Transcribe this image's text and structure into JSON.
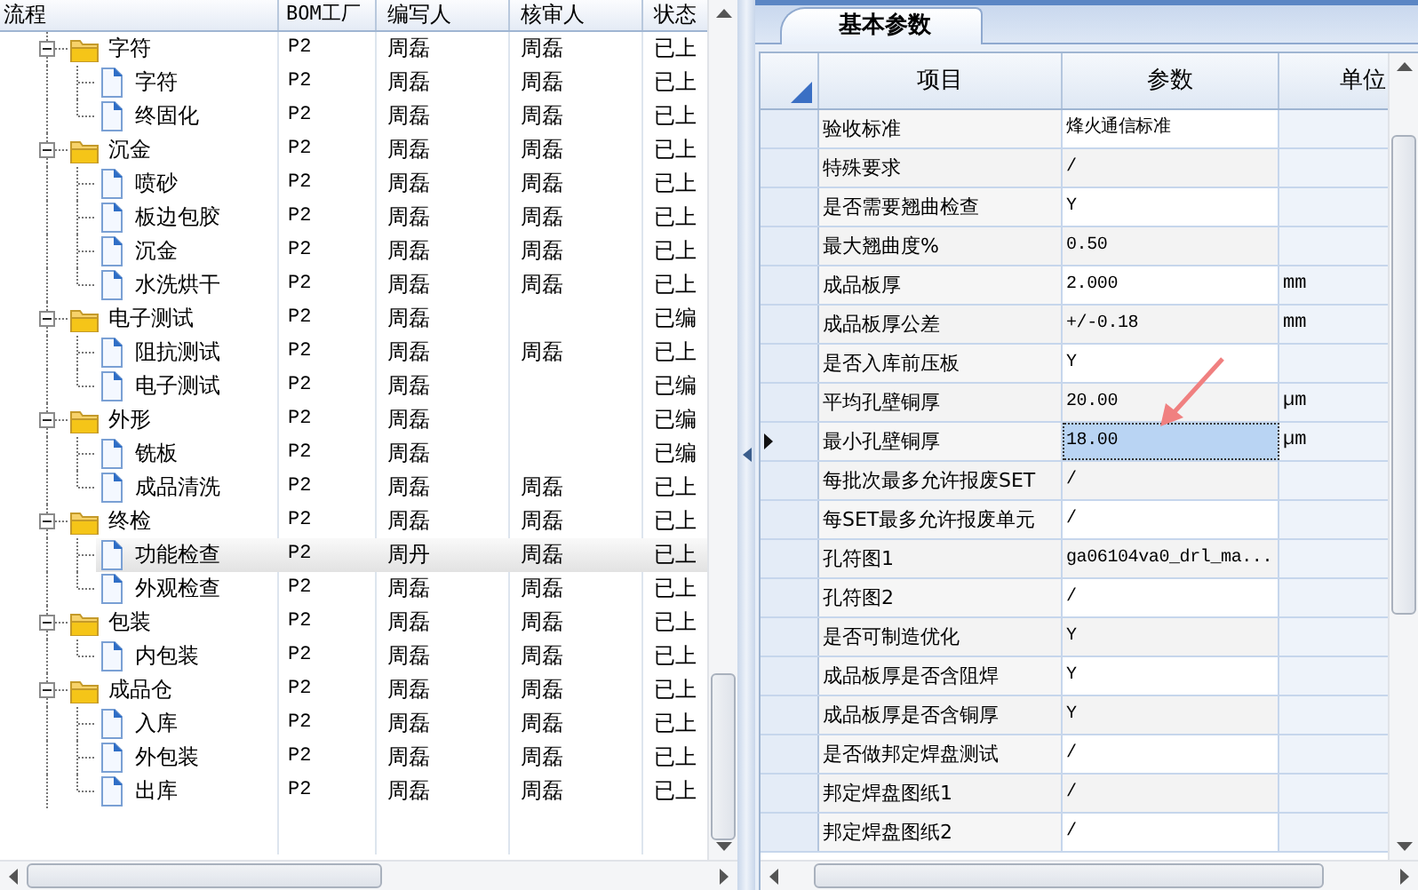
{
  "tree_table": {
    "columns": [
      "流程",
      "BOM工厂",
      "编写人",
      "核审人",
      "状态"
    ],
    "rows": [
      {
        "name": "字符",
        "expanded": true,
        "factory": "P2",
        "author": "周磊",
        "reviewer": "周磊",
        "status": "已上",
        "selected": false,
        "children": [
          {
            "name": "字符",
            "factory": "P2",
            "author": "周磊",
            "reviewer": "周磊",
            "status": "已上",
            "selected": false
          },
          {
            "name": "终固化",
            "factory": "P2",
            "author": "周磊",
            "reviewer": "周磊",
            "status": "已上",
            "selected": false
          }
        ]
      },
      {
        "name": "沉金",
        "expanded": true,
        "factory": "P2",
        "author": "周磊",
        "reviewer": "周磊",
        "status": "已上",
        "selected": false,
        "children": [
          {
            "name": "喷砂",
            "factory": "P2",
            "author": "周磊",
            "reviewer": "周磊",
            "status": "已上",
            "selected": false
          },
          {
            "name": "板边包胶",
            "factory": "P2",
            "author": "周磊",
            "reviewer": "周磊",
            "status": "已上",
            "selected": false
          },
          {
            "name": "沉金",
            "factory": "P2",
            "author": "周磊",
            "reviewer": "周磊",
            "status": "已上",
            "selected": false
          },
          {
            "name": "水洗烘干",
            "factory": "P2",
            "author": "周磊",
            "reviewer": "周磊",
            "status": "已上",
            "selected": false
          }
        ]
      },
      {
        "name": "电子测试",
        "expanded": true,
        "factory": "P2",
        "author": "周磊",
        "status": "已编",
        "selected": false,
        "children": [
          {
            "name": "阻抗测试",
            "factory": "P2",
            "author": "周磊",
            "reviewer": "周磊",
            "status": "已上",
            "selected": false
          },
          {
            "name": "电子测试",
            "factory": "P2",
            "author": "周磊",
            "status": "已编",
            "selected": false
          }
        ]
      },
      {
        "name": "外形",
        "expanded": true,
        "factory": "P2",
        "author": "周磊",
        "status": "已编",
        "selected": false,
        "children": [
          {
            "name": "铣板",
            "factory": "P2",
            "author": "周磊",
            "status": "已编",
            "selected": false
          },
          {
            "name": "成品清洗",
            "factory": "P2",
            "author": "周磊",
            "reviewer": "周磊",
            "status": "已上",
            "selected": false
          }
        ]
      },
      {
        "name": "终检",
        "expanded": true,
        "factory": "P2",
        "author": "周磊",
        "reviewer": "周磊",
        "status": "已上",
        "selected": false,
        "children": [
          {
            "name": "功能检查",
            "factory": "P2",
            "author": "周丹",
            "reviewer": "周磊",
            "status": "已上",
            "selected": true
          },
          {
            "name": "外观检查",
            "factory": "P2",
            "author": "周磊",
            "reviewer": "周磊",
            "status": "已上",
            "selected": false
          }
        ]
      },
      {
        "name": "包装",
        "expanded": true,
        "factory": "P2",
        "author": "周磊",
        "reviewer": "周磊",
        "status": "已上",
        "selected": false,
        "children": [
          {
            "name": "内包装",
            "factory": "P2",
            "author": "周磊",
            "reviewer": "周磊",
            "status": "已上",
            "selected": false
          }
        ]
      },
      {
        "name": "成品仓",
        "expanded": true,
        "factory": "P2",
        "author": "周磊",
        "reviewer": "周磊",
        "status": "已上",
        "selected": false,
        "children": [
          {
            "name": "入库",
            "factory": "P2",
            "author": "周磊",
            "reviewer": "周磊",
            "status": "已上",
            "selected": false
          },
          {
            "name": "外包装",
            "factory": "P2",
            "author": "周磊",
            "reviewer": "周磊",
            "status": "已上",
            "selected": false
          },
          {
            "name": "出库",
            "factory": "P2",
            "author": "周磊",
            "reviewer": "周磊",
            "status": "已上",
            "selected": false
          }
        ]
      }
    ]
  },
  "tabs": [
    {
      "label": "基本参数",
      "selected": true
    }
  ],
  "param_grid": {
    "columns": [
      "项目",
      "参数",
      "单位"
    ],
    "rows": [
      {
        "item": "验收标准",
        "value": "烽火通信标准",
        "selected": false
      },
      {
        "item": "特殊要求",
        "value": "/",
        "selected": false
      },
      {
        "item": "是否需要翘曲检查",
        "value": "Y",
        "selected": false
      },
      {
        "item": "最大翘曲度%",
        "value": "0.50",
        "selected": false
      },
      {
        "item": "成品板厚",
        "value": "2.000",
        "unit": "mm",
        "selected": false
      },
      {
        "item": "成品板厚公差",
        "value": "+/-0.18",
        "unit": "mm",
        "selected": false
      },
      {
        "item": "是否入库前压板",
        "value": "Y",
        "selected": false
      },
      {
        "item": "平均孔壁铜厚",
        "value": "20.00",
        "unit": "µm",
        "selected": false
      },
      {
        "item": "最小孔壁铜厚",
        "value": "18.00",
        "unit": "µm",
        "selected": true
      },
      {
        "item": "每批次最多允许报废SET",
        "value": "/",
        "selected": false
      },
      {
        "item": "每SET最多允许报废单元",
        "value": "/",
        "selected": false
      },
      {
        "item": "孔符图1",
        "value": "ga06104va0_drl_ma...",
        "selected": false
      },
      {
        "item": "孔符图2",
        "value": "/",
        "selected": false
      },
      {
        "item": "是否可制造优化",
        "value": "Y",
        "selected": false
      },
      {
        "item": "成品板厚是否含阻焊",
        "value": "Y",
        "selected": false
      },
      {
        "item": "成品板厚是否含铜厚",
        "value": "Y",
        "selected": false
      },
      {
        "item": "是否做邦定焊盘测试",
        "value": "/",
        "selected": false
      },
      {
        "item": "邦定焊盘图纸1",
        "value": "/",
        "selected": false
      },
      {
        "item": "邦定焊盘图纸2",
        "value": "/",
        "selected": false
      }
    ]
  }
}
